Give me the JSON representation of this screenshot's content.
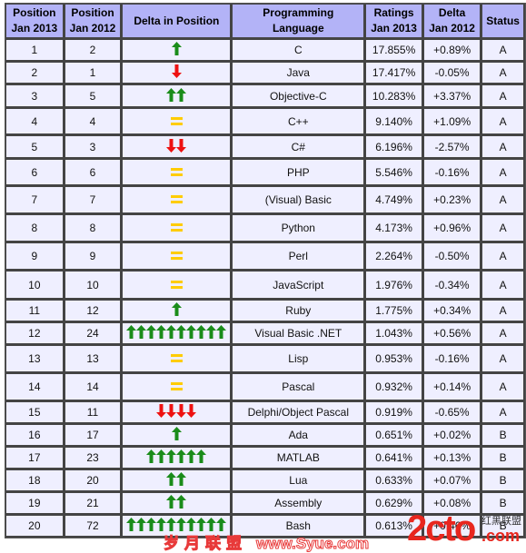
{
  "table": {
    "headers": {
      "pos2013": [
        "Position",
        "Jan 2013"
      ],
      "pos2012": [
        "Position",
        "Jan 2012"
      ],
      "delta_position": "Delta in Position",
      "language": "Programming Language",
      "ratings": [
        "Ratings",
        "Jan 2013"
      ],
      "delta": [
        "Delta",
        "Jan 2012"
      ],
      "status": "Status"
    },
    "colors": {
      "header_bg": "#b3b3f7",
      "row_bg": "#efefff",
      "link": "#1a1a9a",
      "up_arrow": "#1a8c1a",
      "down_arrow": "#ee1111",
      "equal": "#ffcc00"
    },
    "rows": [
      {
        "pos2013": "1",
        "pos2012": "2",
        "trend": "up",
        "count": 1,
        "language": "C",
        "ratings": "17.855%",
        "delta": "+0.89%",
        "status": "A"
      },
      {
        "pos2013": "2",
        "pos2012": "1",
        "trend": "down",
        "count": 1,
        "language": "Java",
        "ratings": "17.417%",
        "delta": "-0.05%",
        "status": "A"
      },
      {
        "pos2013": "3",
        "pos2012": "5",
        "trend": "up",
        "count": 2,
        "language": "Objective-C",
        "ratings": "10.283%",
        "delta": "+3.37%",
        "status": "A"
      },
      {
        "pos2013": "4",
        "pos2012": "4",
        "trend": "same",
        "count": 1,
        "language": "C++",
        "ratings": "9.140%",
        "delta": "+1.09%",
        "status": "A"
      },
      {
        "pos2013": "5",
        "pos2012": "3",
        "trend": "down",
        "count": 2,
        "language": "C#",
        "ratings": "6.196%",
        "delta": "-2.57%",
        "status": "A"
      },
      {
        "pos2013": "6",
        "pos2012": "6",
        "trend": "same",
        "count": 1,
        "language": "PHP",
        "ratings": "5.546%",
        "delta": "-0.16%",
        "status": "A"
      },
      {
        "pos2013": "7",
        "pos2012": "7",
        "trend": "same",
        "count": 1,
        "language": "(Visual) Basic",
        "ratings": "4.749%",
        "delta": "+0.23%",
        "status": "A"
      },
      {
        "pos2013": "8",
        "pos2012": "8",
        "trend": "same",
        "count": 1,
        "language": "Python",
        "ratings": "4.173%",
        "delta": "+0.96%",
        "status": "A"
      },
      {
        "pos2013": "9",
        "pos2012": "9",
        "trend": "same",
        "count": 1,
        "language": "Perl",
        "ratings": "2.264%",
        "delta": "-0.50%",
        "status": "A"
      },
      {
        "pos2013": "10",
        "pos2012": "10",
        "trend": "same",
        "count": 1,
        "language": "JavaScript",
        "ratings": "1.976%",
        "delta": "-0.34%",
        "status": "A"
      },
      {
        "pos2013": "11",
        "pos2012": "12",
        "trend": "up",
        "count": 1,
        "language": "Ruby",
        "ratings": "1.775%",
        "delta": "+0.34%",
        "status": "A"
      },
      {
        "pos2013": "12",
        "pos2012": "24",
        "trend": "up",
        "count": 10,
        "language": "Visual Basic .NET",
        "ratings": "1.043%",
        "delta": "+0.56%",
        "status": "A"
      },
      {
        "pos2013": "13",
        "pos2012": "13",
        "trend": "same",
        "count": 1,
        "language": "Lisp",
        "ratings": "0.953%",
        "delta": "-0.16%",
        "status": "A"
      },
      {
        "pos2013": "14",
        "pos2012": "14",
        "trend": "same",
        "count": 1,
        "language": "Pascal",
        "ratings": "0.932%",
        "delta": "+0.14%",
        "status": "A"
      },
      {
        "pos2013": "15",
        "pos2012": "11",
        "trend": "down",
        "count": 4,
        "language": "Delphi/Object Pascal",
        "ratings": "0.919%",
        "delta": "-0.65%",
        "status": "A"
      },
      {
        "pos2013": "16",
        "pos2012": "17",
        "trend": "up",
        "count": 1,
        "language": "Ada",
        "ratings": "0.651%",
        "delta": "+0.02%",
        "status": "B"
      },
      {
        "pos2013": "17",
        "pos2012": "23",
        "trend": "up",
        "count": 6,
        "language": "MATLAB",
        "ratings": "0.641%",
        "delta": "+0.13%",
        "status": "B"
      },
      {
        "pos2013": "18",
        "pos2012": "20",
        "trend": "up",
        "count": 2,
        "language": "Lua",
        "ratings": "0.633%",
        "delta": "+0.07%",
        "status": "B"
      },
      {
        "pos2013": "19",
        "pos2012": "21",
        "trend": "up",
        "count": 2,
        "language": "Assembly",
        "ratings": "0.629%",
        "delta": "+0.08%",
        "status": "B"
      },
      {
        "pos2013": "20",
        "pos2012": "72",
        "trend": "up",
        "count": 10,
        "language": "Bash",
        "ratings": "0.613%",
        "delta": "+0.46%",
        "status": "B"
      }
    ]
  },
  "watermarks": {
    "syue_cn": "岁月联盟",
    "syue_url": "www.Syue.com",
    "cto_logo": "2cto",
    "cto_cn": "红黑联盟",
    "cto_com": ".com"
  }
}
